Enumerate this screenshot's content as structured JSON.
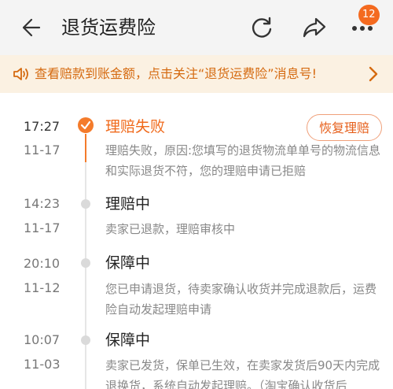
{
  "header": {
    "title": "退货运费险",
    "badge_count": "12"
  },
  "notice": {
    "text": "查看赔款到账金额，点击关注“退货运费险”消息号!"
  },
  "timeline": [
    {
      "time": "17:27",
      "date": "11-17",
      "status": "理赔失败",
      "description": "理赔失败，原因:您填写的退货物流单单号的物流信息和实际退货不符，您的理赔申请已拒赔",
      "action_label": "恢复理赔"
    },
    {
      "time": "14:23",
      "date": "11-17",
      "status": "理赔中",
      "description": "卖家已退款，理赔审核中"
    },
    {
      "time": "20:10",
      "date": "11-12",
      "status": "保障中",
      "description": "您已申请退货，待卖家确认收货并完成退款后，运费险自动发起理赔申请"
    },
    {
      "time": "10:07",
      "date": "11-03",
      "status": "保障中",
      "description": "卖家已发货，保单已生效，在卖家发货后90天内完成退换货，系统自动发起理赔。（淘宝确认收货后"
    }
  ],
  "colors": {
    "accent": "#f47b2b",
    "notice_bg": "#fbf1e2",
    "notice_text": "#d56a10"
  }
}
